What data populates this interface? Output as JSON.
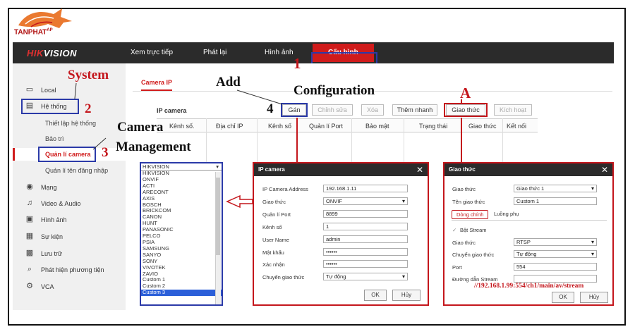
{
  "logo": {
    "text": "TANPHAT",
    "sup": "AP"
  },
  "topbar": {
    "brand_hi": "HIK",
    "brand_rest": "VISION",
    "tabs": [
      "Xem trực tiếp",
      "Phát lại",
      "Hình ảnh",
      "Cấu hình"
    ]
  },
  "sidebar": {
    "items": [
      "Local",
      "Hệ thống",
      "Mạng",
      "Video & Audio",
      "Hình ảnh",
      "Sự kiện",
      "Lưu trữ",
      "Phát hiện phương tiện",
      "VCA"
    ],
    "sub_items": [
      "Thiết lập hệ thống",
      "Bảo trì",
      "Quản lí camera",
      "Quản lí tên đăng nhập"
    ]
  },
  "main": {
    "tab": "Camera IP",
    "panel_title": "IP camera",
    "buttons": [
      "Gán",
      "Chỉnh sửa",
      "Xóa",
      "Thêm nhanh",
      "Giao thức",
      "Kích hoạt"
    ],
    "columns": [
      "Kênh số.",
      "Địa chỉ IP",
      "Kênh số",
      "Quản lí Port",
      "Bảo mật",
      "Trạng thái",
      "Giao thức",
      "Kết nối"
    ]
  },
  "callouts": {
    "system": "System",
    "n2": "2",
    "camera": "Camera",
    "management": "Management",
    "n3": "3",
    "add": "Add",
    "n4": "4",
    "n1": "1",
    "configuration": "Configuration",
    "a": "A"
  },
  "dropdown": {
    "selected": "HIKVISION",
    "options": [
      "HIKVISION",
      "ONVIF",
      "ACTI",
      "ARECONT",
      "AXIS",
      "BOSCH",
      "BRICKCOM",
      "CANON",
      "HUNT",
      "PANASONIC",
      "PELCO",
      "PSIA",
      "SAMSUNG",
      "SANYO",
      "SONY",
      "VIVOTEK",
      "ZAVIO",
      "Custom 1",
      "Custom 2",
      "Custom 3"
    ]
  },
  "ipdialog": {
    "title": "IP camera",
    "close": "✕",
    "fields": [
      {
        "label": "IP Camera Address",
        "value": "192.168.1.11"
      },
      {
        "label": "Giao thức",
        "value": "ONVIF"
      },
      {
        "label": "Quản lí Port",
        "value": "8899"
      },
      {
        "label": "Kênh số",
        "value": "1"
      },
      {
        "label": "User Name",
        "value": "admin"
      },
      {
        "label": "Mật khẩu",
        "value": "••••••"
      },
      {
        "label": "Xác nhận",
        "value": "••••••"
      },
      {
        "label": "Chuyển giao thức",
        "value": "Tự động"
      }
    ],
    "ok": "OK",
    "cancel": "Hủy"
  },
  "protodialog": {
    "title": "Giao thức",
    "close": "✕",
    "protocol_label": "Giao thức",
    "protocol_value": "Giao thức 1",
    "name_label": "Tên giao thức",
    "name_value": "Custom 1",
    "subtab_main": "Dòng chính",
    "subtab_sub": "Luồng phụ",
    "enable_stream": "Bật Stream",
    "fields": [
      {
        "label": "Giao thức",
        "value": "RTSP"
      },
      {
        "label": "Chuyển giao thức",
        "value": "Tự động"
      },
      {
        "label": "Port",
        "value": "554"
      },
      {
        "label": "Đường dẫn Stream",
        "value": ""
      }
    ],
    "stream_url": "//192.168.1.99:554/ch1/main/av/stream",
    "ok": "OK",
    "cancel": "Hủy"
  },
  "colors": {
    "accent": "#d01b1b",
    "highlight_blue": "#2b3aa8",
    "callout_red": "#c4161c"
  }
}
